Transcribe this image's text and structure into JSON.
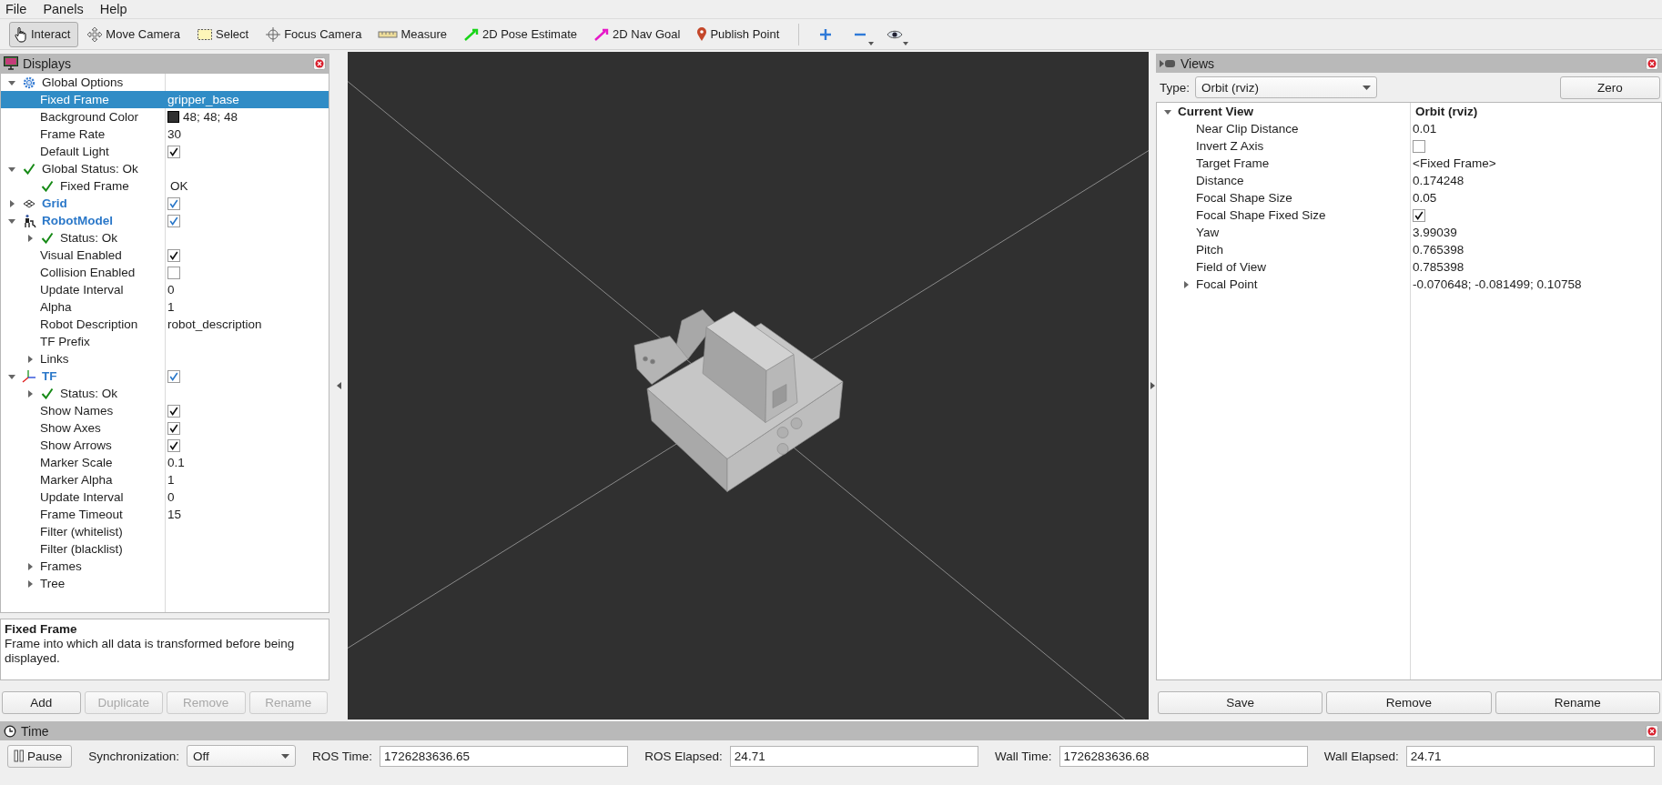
{
  "menu": [
    {
      "label": "File"
    },
    {
      "label": "Panels"
    },
    {
      "label": "Help"
    }
  ],
  "toolbar": {
    "tools": [
      {
        "label": "Interact",
        "kind": "interact",
        "selected": true
      },
      {
        "label": "Move Camera",
        "kind": "move",
        "selected": false
      },
      {
        "label": "Select",
        "kind": "select",
        "selected": false
      },
      {
        "label": "Focus Camera",
        "kind": "focus",
        "selected": false
      },
      {
        "label": "Measure",
        "kind": "measure",
        "selected": false
      },
      {
        "label": "2D Pose Estimate",
        "kind": "pose",
        "selected": false
      },
      {
        "label": "2D Nav Goal",
        "kind": "nav",
        "selected": false
      },
      {
        "label": "Publish Point",
        "kind": "point",
        "selected": false
      }
    ],
    "view_buttons": [
      {
        "kind": "add",
        "has_menu": false
      },
      {
        "kind": "remove",
        "has_menu": true
      },
      {
        "kind": "eye",
        "has_menu": true
      }
    ]
  },
  "displays": {
    "title": "Displays",
    "tree": [
      {
        "label": "Global Options",
        "kind": "options",
        "expanded": true,
        "selected": false,
        "children": [
          {
            "label": "Fixed Frame",
            "value": "gripper_base",
            "kind": "property",
            "selected": true
          },
          {
            "label": "Background Color",
            "value": "48; 48; 48",
            "color": "#303030",
            "kind": "property",
            "selected": false
          },
          {
            "label": "Frame Rate",
            "value": "30",
            "kind": "property",
            "selected": false
          },
          {
            "label": "Default Light",
            "checked": true,
            "kind": "property",
            "selected": false
          }
        ]
      },
      {
        "label": "Global Status: Ok",
        "kind": "status",
        "expanded": true,
        "selected": false,
        "children": [
          {
            "label": "Fixed Frame",
            "value": "OK",
            "kind": "status",
            "selected": false
          }
        ]
      },
      {
        "label": "Grid",
        "kind": "grid",
        "expanded": false,
        "checked": true,
        "selected": false
      },
      {
        "label": "RobotModel",
        "kind": "robot",
        "expanded": true,
        "checked": true,
        "selected": false,
        "children": [
          {
            "label": "Status: Ok",
            "kind": "status",
            "expanded": false,
            "selected": false
          },
          {
            "label": "Visual Enabled",
            "checked": true,
            "kind": "property",
            "selected": false
          },
          {
            "label": "Collision Enabled",
            "checked": false,
            "kind": "property",
            "selected": false
          },
          {
            "label": "Update Interval",
            "value": "0",
            "kind": "property",
            "selected": false
          },
          {
            "label": "Alpha",
            "value": "1",
            "kind": "property",
            "selected": false
          },
          {
            "label": "Robot Description",
            "value": "robot_description",
            "kind": "property",
            "selected": false
          },
          {
            "label": "TF Prefix",
            "kind": "property",
            "selected": false
          },
          {
            "label": "Links",
            "kind": "property",
            "expanded": false,
            "selected": false
          }
        ]
      },
      {
        "label": "TF",
        "kind": "tf",
        "expanded": true,
        "checked": true,
        "selected": false,
        "children": [
          {
            "label": "Status: Ok",
            "kind": "status",
            "expanded": false,
            "selected": false
          },
          {
            "label": "Show Names",
            "checked": true,
            "kind": "property",
            "selected": false
          },
          {
            "label": "Show Axes",
            "checked": true,
            "kind": "property",
            "selected": false
          },
          {
            "label": "Show Arrows",
            "checked": true,
            "kind": "property",
            "selected": false
          },
          {
            "label": "Marker Scale",
            "value": "0.1",
            "kind": "property",
            "selected": false
          },
          {
            "label": "Marker Alpha",
            "value": "1",
            "kind": "property",
            "selected": false
          },
          {
            "label": "Update Interval",
            "value": "0",
            "kind": "property",
            "selected": false
          },
          {
            "label": "Frame Timeout",
            "value": "15",
            "kind": "property",
            "selected": false
          },
          {
            "label": "Filter (whitelist)",
            "kind": "property",
            "selected": false
          },
          {
            "label": "Filter (blacklist)",
            "kind": "property",
            "selected": false
          },
          {
            "label": "Frames",
            "kind": "property",
            "expanded": false,
            "selected": false
          },
          {
            "label": "Tree",
            "kind": "property",
            "expanded": false,
            "selected": false
          }
        ]
      }
    ],
    "description": {
      "title": "Fixed Frame",
      "text": "Frame into which all data is transformed before being displayed."
    },
    "buttons": [
      {
        "label": "Add",
        "disabled": false
      },
      {
        "label": "Duplicate",
        "disabled": true
      },
      {
        "label": "Remove",
        "disabled": true
      },
      {
        "label": "Rename",
        "disabled": true
      }
    ]
  },
  "views": {
    "title": "Views",
    "type_label": "Type:",
    "type_value": "Orbit (rviz)",
    "zero_button": "Zero",
    "tree": [
      {
        "label": "Current View",
        "value": "Orbit (rviz)",
        "kind": "header",
        "expanded": true,
        "selected": false,
        "children": [
          {
            "label": "Near Clip Distance",
            "value": "0.01",
            "kind": "property",
            "selected": false
          },
          {
            "label": "Invert Z Axis",
            "checked": false,
            "kind": "property",
            "selected": false
          },
          {
            "label": "Target Frame",
            "value": "<Fixed Frame>",
            "kind": "property",
            "selected": false
          },
          {
            "label": "Distance",
            "value": "0.174248",
            "kind": "property",
            "selected": false
          },
          {
            "label": "Focal Shape Size",
            "value": "0.05",
            "kind": "property",
            "selected": false
          },
          {
            "label": "Focal Shape Fixed Size",
            "checked": true,
            "kind": "property",
            "selected": false
          },
          {
            "label": "Yaw",
            "value": "3.99039",
            "kind": "property",
            "selected": false
          },
          {
            "label": "Pitch",
            "value": "0.765398",
            "kind": "property",
            "selected": false
          },
          {
            "label": "Field of View",
            "value": "0.785398",
            "kind": "property",
            "selected": false
          },
          {
            "label": "Focal Point",
            "value": "-0.070648; -0.081499; 0.10758",
            "kind": "property",
            "expanded": false,
            "selected": false
          }
        ]
      }
    ],
    "buttons": [
      {
        "label": "Save",
        "disabled": false
      },
      {
        "label": "Remove",
        "disabled": false
      },
      {
        "label": "Rename",
        "disabled": false
      }
    ]
  },
  "time": {
    "title": "Time",
    "pause_button": "Pause",
    "sync_label": "Synchronization:",
    "sync_value": "Off",
    "fields": [
      {
        "label": "ROS Time:",
        "value": "1726283636.65"
      },
      {
        "label": "ROS Elapsed:",
        "value": "24.71"
      },
      {
        "label": "Wall Time:",
        "value": "1726283636.68"
      },
      {
        "label": "Wall Elapsed:",
        "value": "24.71"
      }
    ]
  }
}
